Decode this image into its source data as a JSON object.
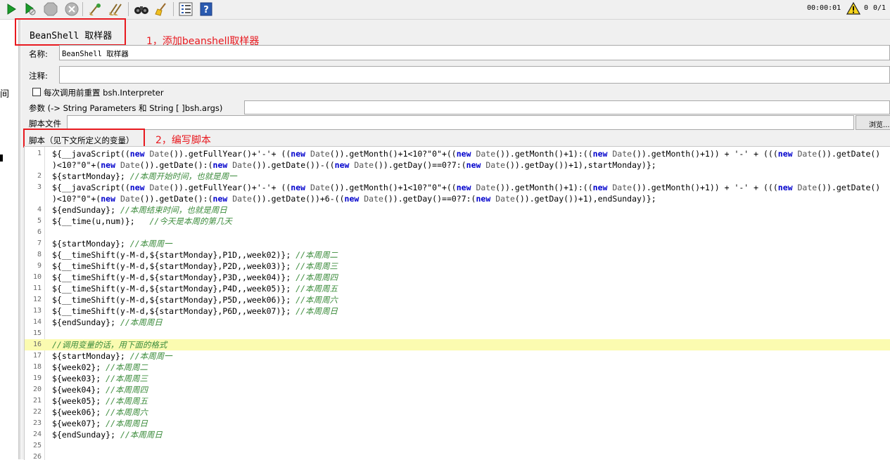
{
  "toolbar": {
    "buttons": [
      {
        "name": "start-icon"
      },
      {
        "name": "start-no-pause-icon"
      },
      {
        "name": "stop-icon"
      },
      {
        "name": "shutdown-icon"
      },
      {
        "name": "clear-icon"
      },
      {
        "name": "clear-all-icon"
      },
      {
        "name": "search-binoculars-icon"
      },
      {
        "name": "reset-search-broom-icon"
      },
      {
        "name": "function-helper-icon"
      },
      {
        "name": "help-icon"
      }
    ],
    "timer": "00:00:01",
    "warning_count": "0",
    "thread_count": "0/1"
  },
  "tree": {
    "fragment": "间"
  },
  "panel": {
    "title": "BeanShell 取样器",
    "annotation_1": "1，添加beanshell取样器",
    "name_label": "名称:",
    "name_value": "BeanShell 取样器",
    "comment_label": "注释:",
    "comment_value": "",
    "reset_label": "每次调用前重置 bsh.Interpreter",
    "params_label": "参数 (-> String Parameters 和 String [ ]bsh.args)",
    "params_value": "",
    "script_file_label": "脚本文件",
    "script_file_value": "",
    "browse_label": "浏览...",
    "script_label": "脚本（见下文所定义的变量）",
    "annotation_2": "2，编写脚本"
  },
  "editor": {
    "highlighted_line": 16,
    "colors": {
      "keyword": "#0000cc",
      "comment": "#3c8c3c",
      "highlight": "#fbfbb0",
      "annotation": "#e8191f"
    },
    "lines": [
      {
        "n": "1",
        "text": "${__javaScript((new Date()).getFullYear()+'-'+ ((new Date()).getMonth()+1<10?\"0\"+((new Date()).getMonth()+1):((new Date()).getMonth()+1)) + '-' + (((new Date()).getDate()"
      },
      {
        "n": "",
        "text": ")<10?\"0\"+(new Date()).getDate():(new Date()).getDate())-((new Date()).getDay()==0?7:(new Date()).getDay())+1),startMonday)};"
      },
      {
        "n": "2",
        "text": "${startMonday}; //本周开始时间，也就是周一"
      },
      {
        "n": "3",
        "text": "${__javaScript((new Date()).getFullYear()+'-'+ ((new Date()).getMonth()+1<10?\"0\"+((new Date()).getMonth()+1):((new Date()).getMonth()+1)) + '-' + (((new Date()).getDate()"
      },
      {
        "n": "",
        "text": ")<10?\"0\"+(new Date()).getDate():(new Date()).getDate())+6-((new Date()).getDay()==0?7:(new Date()).getDay())+1),endSunday)};"
      },
      {
        "n": "4",
        "text": "${endSunday}; //本周结束时间，也就是周日"
      },
      {
        "n": "5",
        "text": "${__time(u,num)};   //今天是本周的第几天"
      },
      {
        "n": "6",
        "text": ""
      },
      {
        "n": "7",
        "text": "${startMonday}; //本周周一"
      },
      {
        "n": "8",
        "text": "${__timeShift(y-M-d,${startMonday},P1D,,week02)}; //本周周二"
      },
      {
        "n": "9",
        "text": "${__timeShift(y-M-d,${startMonday},P2D,,week03)}; //本周周三"
      },
      {
        "n": "10",
        "text": "${__timeShift(y-M-d,${startMonday},P3D,,week04)}; //本周周四"
      },
      {
        "n": "11",
        "text": "${__timeShift(y-M-d,${startMonday},P4D,,week05)}; //本周周五"
      },
      {
        "n": "12",
        "text": "${__timeShift(y-M-d,${startMonday},P5D,,week06)}; //本周周六"
      },
      {
        "n": "13",
        "text": "${__timeShift(y-M-d,${startMonday},P6D,,week07)}; //本周周日"
      },
      {
        "n": "14",
        "text": "${endSunday}; //本周周日"
      },
      {
        "n": "15",
        "text": ""
      },
      {
        "n": "16",
        "text": "//调用变量的话，用下面的格式"
      },
      {
        "n": "17",
        "text": "${startMonday}; //本周周一"
      },
      {
        "n": "18",
        "text": "${week02}; //本周周二"
      },
      {
        "n": "19",
        "text": "${week03}; //本周周三"
      },
      {
        "n": "20",
        "text": "${week04}; //本周周四"
      },
      {
        "n": "21",
        "text": "${week05}; //本周周五"
      },
      {
        "n": "22",
        "text": "${week06}; //本周周六"
      },
      {
        "n": "23",
        "text": "${week07}; //本周周日"
      },
      {
        "n": "24",
        "text": "${endSunday}; //本周周日"
      },
      {
        "n": "25",
        "text": ""
      },
      {
        "n": "26",
        "text": ""
      }
    ]
  }
}
